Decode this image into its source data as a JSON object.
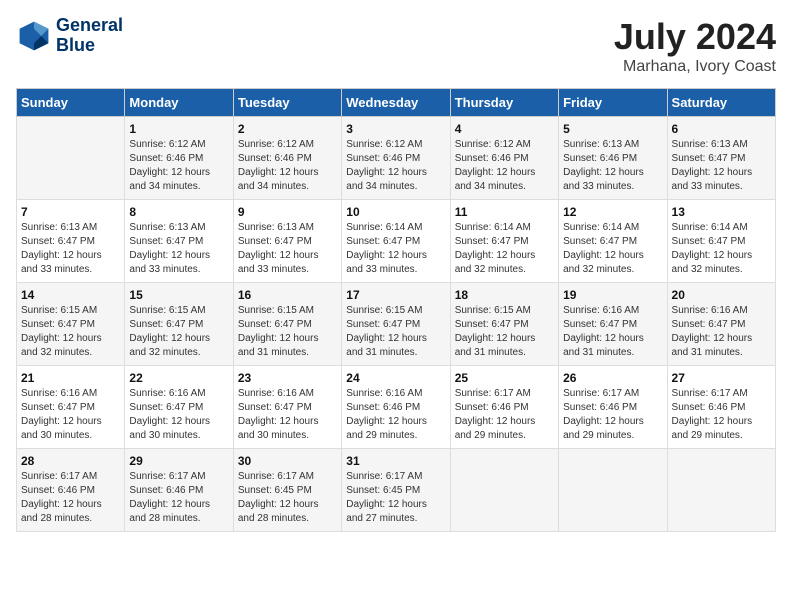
{
  "logo": {
    "line1": "General",
    "line2": "Blue"
  },
  "title": "July 2024",
  "subtitle": "Marhana, Ivory Coast",
  "days_of_week": [
    "Sunday",
    "Monday",
    "Tuesday",
    "Wednesday",
    "Thursday",
    "Friday",
    "Saturday"
  ],
  "weeks": [
    [
      {
        "day": "",
        "sunrise": "",
        "sunset": "",
        "daylight": ""
      },
      {
        "day": "1",
        "sunrise": "Sunrise: 6:12 AM",
        "sunset": "Sunset: 6:46 PM",
        "daylight": "Daylight: 12 hours and 34 minutes."
      },
      {
        "day": "2",
        "sunrise": "Sunrise: 6:12 AM",
        "sunset": "Sunset: 6:46 PM",
        "daylight": "Daylight: 12 hours and 34 minutes."
      },
      {
        "day": "3",
        "sunrise": "Sunrise: 6:12 AM",
        "sunset": "Sunset: 6:46 PM",
        "daylight": "Daylight: 12 hours and 34 minutes."
      },
      {
        "day": "4",
        "sunrise": "Sunrise: 6:12 AM",
        "sunset": "Sunset: 6:46 PM",
        "daylight": "Daylight: 12 hours and 34 minutes."
      },
      {
        "day": "5",
        "sunrise": "Sunrise: 6:13 AM",
        "sunset": "Sunset: 6:46 PM",
        "daylight": "Daylight: 12 hours and 33 minutes."
      },
      {
        "day": "6",
        "sunrise": "Sunrise: 6:13 AM",
        "sunset": "Sunset: 6:47 PM",
        "daylight": "Daylight: 12 hours and 33 minutes."
      }
    ],
    [
      {
        "day": "7",
        "sunrise": "Sunrise: 6:13 AM",
        "sunset": "Sunset: 6:47 PM",
        "daylight": "Daylight: 12 hours and 33 minutes."
      },
      {
        "day": "8",
        "sunrise": "Sunrise: 6:13 AM",
        "sunset": "Sunset: 6:47 PM",
        "daylight": "Daylight: 12 hours and 33 minutes."
      },
      {
        "day": "9",
        "sunrise": "Sunrise: 6:13 AM",
        "sunset": "Sunset: 6:47 PM",
        "daylight": "Daylight: 12 hours and 33 minutes."
      },
      {
        "day": "10",
        "sunrise": "Sunrise: 6:14 AM",
        "sunset": "Sunset: 6:47 PM",
        "daylight": "Daylight: 12 hours and 33 minutes."
      },
      {
        "day": "11",
        "sunrise": "Sunrise: 6:14 AM",
        "sunset": "Sunset: 6:47 PM",
        "daylight": "Daylight: 12 hours and 32 minutes."
      },
      {
        "day": "12",
        "sunrise": "Sunrise: 6:14 AM",
        "sunset": "Sunset: 6:47 PM",
        "daylight": "Daylight: 12 hours and 32 minutes."
      },
      {
        "day": "13",
        "sunrise": "Sunrise: 6:14 AM",
        "sunset": "Sunset: 6:47 PM",
        "daylight": "Daylight: 12 hours and 32 minutes."
      }
    ],
    [
      {
        "day": "14",
        "sunrise": "Sunrise: 6:15 AM",
        "sunset": "Sunset: 6:47 PM",
        "daylight": "Daylight: 12 hours and 32 minutes."
      },
      {
        "day": "15",
        "sunrise": "Sunrise: 6:15 AM",
        "sunset": "Sunset: 6:47 PM",
        "daylight": "Daylight: 12 hours and 32 minutes."
      },
      {
        "day": "16",
        "sunrise": "Sunrise: 6:15 AM",
        "sunset": "Sunset: 6:47 PM",
        "daylight": "Daylight: 12 hours and 31 minutes."
      },
      {
        "day": "17",
        "sunrise": "Sunrise: 6:15 AM",
        "sunset": "Sunset: 6:47 PM",
        "daylight": "Daylight: 12 hours and 31 minutes."
      },
      {
        "day": "18",
        "sunrise": "Sunrise: 6:15 AM",
        "sunset": "Sunset: 6:47 PM",
        "daylight": "Daylight: 12 hours and 31 minutes."
      },
      {
        "day": "19",
        "sunrise": "Sunrise: 6:16 AM",
        "sunset": "Sunset: 6:47 PM",
        "daylight": "Daylight: 12 hours and 31 minutes."
      },
      {
        "day": "20",
        "sunrise": "Sunrise: 6:16 AM",
        "sunset": "Sunset: 6:47 PM",
        "daylight": "Daylight: 12 hours and 31 minutes."
      }
    ],
    [
      {
        "day": "21",
        "sunrise": "Sunrise: 6:16 AM",
        "sunset": "Sunset: 6:47 PM",
        "daylight": "Daylight: 12 hours and 30 minutes."
      },
      {
        "day": "22",
        "sunrise": "Sunrise: 6:16 AM",
        "sunset": "Sunset: 6:47 PM",
        "daylight": "Daylight: 12 hours and 30 minutes."
      },
      {
        "day": "23",
        "sunrise": "Sunrise: 6:16 AM",
        "sunset": "Sunset: 6:47 PM",
        "daylight": "Daylight: 12 hours and 30 minutes."
      },
      {
        "day": "24",
        "sunrise": "Sunrise: 6:16 AM",
        "sunset": "Sunset: 6:46 PM",
        "daylight": "Daylight: 12 hours and 29 minutes."
      },
      {
        "day": "25",
        "sunrise": "Sunrise: 6:17 AM",
        "sunset": "Sunset: 6:46 PM",
        "daylight": "Daylight: 12 hours and 29 minutes."
      },
      {
        "day": "26",
        "sunrise": "Sunrise: 6:17 AM",
        "sunset": "Sunset: 6:46 PM",
        "daylight": "Daylight: 12 hours and 29 minutes."
      },
      {
        "day": "27",
        "sunrise": "Sunrise: 6:17 AM",
        "sunset": "Sunset: 6:46 PM",
        "daylight": "Daylight: 12 hours and 29 minutes."
      }
    ],
    [
      {
        "day": "28",
        "sunrise": "Sunrise: 6:17 AM",
        "sunset": "Sunset: 6:46 PM",
        "daylight": "Daylight: 12 hours and 28 minutes."
      },
      {
        "day": "29",
        "sunrise": "Sunrise: 6:17 AM",
        "sunset": "Sunset: 6:46 PM",
        "daylight": "Daylight: 12 hours and 28 minutes."
      },
      {
        "day": "30",
        "sunrise": "Sunrise: 6:17 AM",
        "sunset": "Sunset: 6:45 PM",
        "daylight": "Daylight: 12 hours and 28 minutes."
      },
      {
        "day": "31",
        "sunrise": "Sunrise: 6:17 AM",
        "sunset": "Sunset: 6:45 PM",
        "daylight": "Daylight: 12 hours and 27 minutes."
      },
      {
        "day": "",
        "sunrise": "",
        "sunset": "",
        "daylight": ""
      },
      {
        "day": "",
        "sunrise": "",
        "sunset": "",
        "daylight": ""
      },
      {
        "day": "",
        "sunrise": "",
        "sunset": "",
        "daylight": ""
      }
    ]
  ],
  "colors": {
    "header_bg": "#1a5fa8",
    "header_text": "#ffffff",
    "odd_row_bg": "#f5f5f5",
    "even_row_bg": "#ffffff"
  }
}
